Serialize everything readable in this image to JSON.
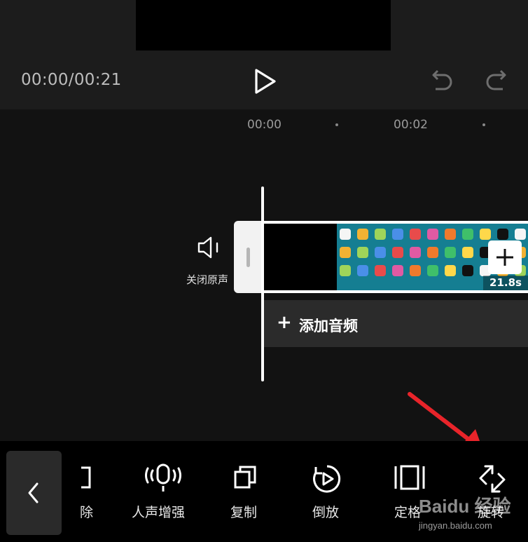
{
  "player": {
    "timecode": "00:00/00:21",
    "icons": {
      "play": "play-icon",
      "undo": "undo-icon",
      "redo": "redo-icon"
    }
  },
  "ruler": {
    "labels": [
      "00:00",
      "00:02"
    ]
  },
  "audio_track": {
    "mute_label": "关闭原声",
    "mute_icon": "speaker-icon",
    "add_audio_label": "添加音频"
  },
  "video_clip": {
    "duration": "21.8s",
    "add_clip_icon": "plus-icon"
  },
  "toolbar": {
    "back_icon": "chevron-left-icon",
    "tools": [
      {
        "label": "除",
        "icon": "delete-partial-icon"
      },
      {
        "label": "人声增强",
        "icon": "microphone-icon"
      },
      {
        "label": "复制",
        "icon": "copy-icon"
      },
      {
        "label": "倒放",
        "icon": "reverse-play-icon"
      },
      {
        "label": "定格",
        "icon": "freeze-frame-icon"
      },
      {
        "label": "旋转",
        "icon": "rotate-icon"
      }
    ]
  },
  "watermark": {
    "brand": "Baidu 经验",
    "url": "jingyan.baidu.com"
  },
  "colors": {
    "accent_arrow": "#e8242a",
    "clip_bg": "#157e92"
  }
}
